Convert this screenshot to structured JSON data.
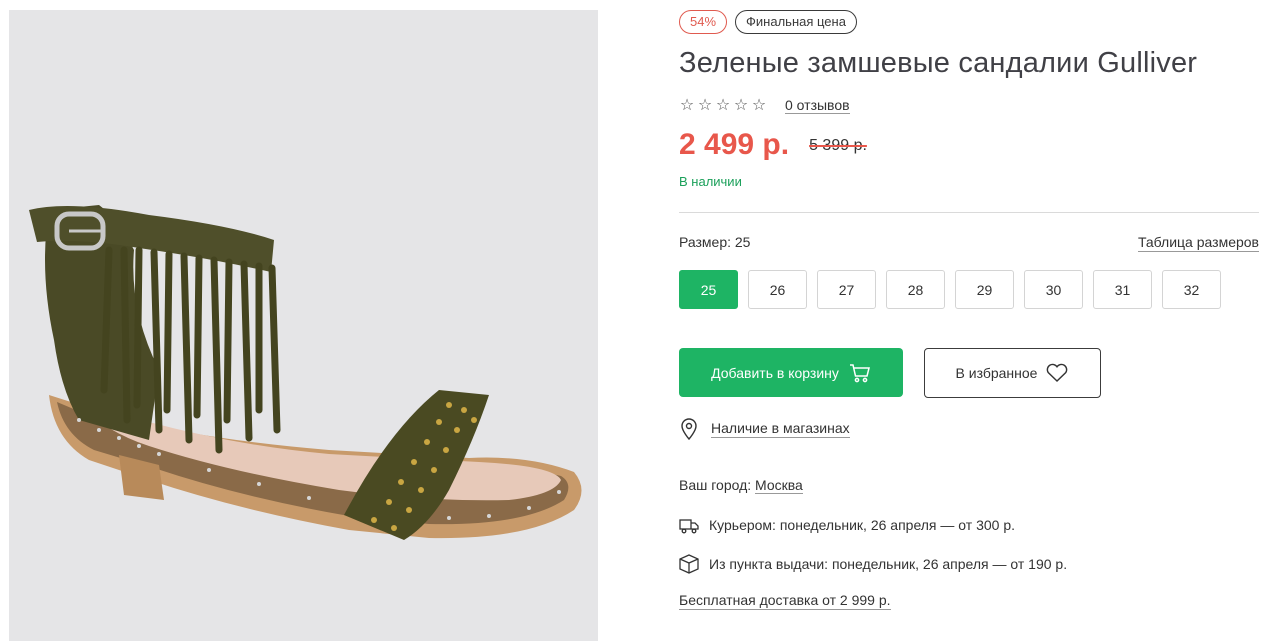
{
  "product": {
    "badges": {
      "discount": "54%",
      "final_price": "Финальная цена"
    },
    "title": "Зеленые замшевые сандалии Gulliver",
    "rating": {
      "stars_filled": 0,
      "stars_total": 5,
      "reviews_label": "0 отзывов"
    },
    "price": {
      "current": "2 499 р.",
      "old": "5 399 р."
    },
    "stock": "В наличии"
  },
  "sizes": {
    "label": "Размер: 25",
    "table_link": "Таблица размеров",
    "options": [
      "25",
      "26",
      "27",
      "28",
      "29",
      "30",
      "31",
      "32"
    ],
    "selected": "25"
  },
  "actions": {
    "cart_label": "Добавить в корзину",
    "cart_icon": "cart-icon",
    "favorite_label": "В избранное",
    "favorite_icon": "heart-icon"
  },
  "stores": {
    "label": "Наличие в магазинах",
    "icon": "location-pin-icon"
  },
  "delivery": {
    "city_label": "Ваш город:",
    "city": "Москва",
    "courier": "Курьером: понедельник, 26 апреля — от 300 р.",
    "courier_icon": "truck-icon",
    "pickup": "Из пункта выдачи: понедельник, 26 апреля — от 190 р.",
    "pickup_icon": "box-icon",
    "free": "Бесплатная доставка от 2 999 р."
  },
  "colors": {
    "accent_green": "#1eb464",
    "price_red": "#e8574b",
    "stock_green": "#1ba05a",
    "sandal_suede": "#4a4a26",
    "sole": "#c89a6a"
  }
}
